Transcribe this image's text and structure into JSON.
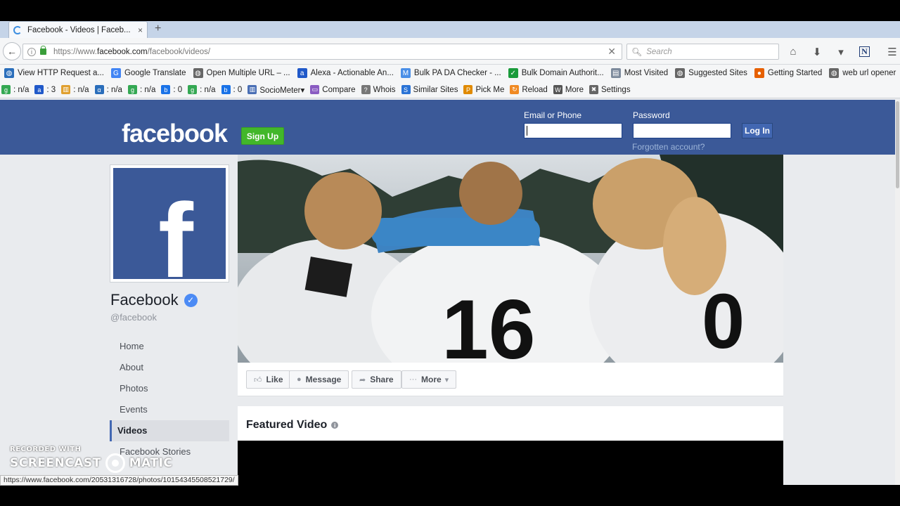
{
  "browser": {
    "tab_title": "Facebook - Videos | Faceb...",
    "tab_close": "×",
    "new_tab": "+",
    "url_prefix": "https://www.",
    "url_domain": "facebook.com",
    "url_path": "/facebook/videos/",
    "search_placeholder": "Search",
    "bookmarks": [
      {
        "label": "View HTTP Request a...",
        "icon": "globe-icon",
        "color": "#2a6ebb"
      },
      {
        "label": "Google Translate",
        "icon": "translate-icon",
        "color": "#4285f4"
      },
      {
        "label": "Open Multiple URL – ...",
        "icon": "globe-icon",
        "color": "#666666"
      },
      {
        "label": "Alexa - Actionable An...",
        "icon": "alexa-icon",
        "color": "#2059c9"
      },
      {
        "label": "Bulk PA DA Checker - ...",
        "icon": "m-icon",
        "color": "#4a8fe7"
      },
      {
        "label": "Bulk Domain Authorit...",
        "icon": "check-icon",
        "color": "#1a9b3b"
      },
      {
        "label": "Most Visited",
        "icon": "folder-icon",
        "color": "#7c8a9c"
      },
      {
        "label": "Suggested Sites",
        "icon": "globe-icon",
        "color": "#666666"
      },
      {
        "label": "Getting Started",
        "icon": "firefox-icon",
        "color": "#e66000"
      },
      {
        "label": "web url opener",
        "icon": "globe-icon",
        "color": "#666666"
      }
    ],
    "toolbar": [
      {
        "label": ": n/a",
        "icon": "google-icon",
        "color": "#34a853"
      },
      {
        "label": ": 3",
        "icon": "alexa-icon",
        "color": "#2059c9"
      },
      {
        "label": ": n/a",
        "icon": "stats-icon",
        "color": "#e0a030"
      },
      {
        "label": ": n/a",
        "icon": "alpha-icon",
        "color": "#2a6ebb"
      },
      {
        "label": ": n/a",
        "icon": "google-icon",
        "color": "#34a853"
      },
      {
        "label": ": 0",
        "icon": "bing-icon",
        "color": "#1a73e8"
      },
      {
        "label": ": n/a",
        "icon": "google-icon",
        "color": "#34a853"
      },
      {
        "label": ": 0",
        "icon": "bing-icon",
        "color": "#1a73e8"
      },
      {
        "label": "SocioMeter▾",
        "icon": "bars-icon",
        "color": "#4a6fb5"
      },
      {
        "label": "Compare",
        "icon": "compare-icon",
        "color": "#8a5cc2"
      },
      {
        "label": "Whois",
        "icon": "question-icon",
        "color": "#777777"
      },
      {
        "label": "Similar Sites",
        "icon": "s-icon",
        "color": "#2a73d6"
      },
      {
        "label": "Pick Me",
        "icon": "pick-icon",
        "color": "#e08a00"
      },
      {
        "label": "Reload",
        "icon": "reload-icon",
        "color": "#f08a24"
      },
      {
        "label": "More",
        "icon": "more-icon",
        "color": "#555555"
      },
      {
        "label": "Settings",
        "icon": "tools-icon",
        "color": "#666666"
      }
    ],
    "status_url": "https://www.facebook.com/20531316728/photos/10154345508521729/"
  },
  "fb": {
    "logo": "facebook",
    "signup": "Sign Up",
    "email_label": "Email or Phone",
    "password_label": "Password",
    "login": "Log In",
    "forgot": "Forgotten account?",
    "page_name": "Facebook",
    "verified": "✓",
    "handle": "@facebook",
    "nav": [
      {
        "label": "Home",
        "active": false
      },
      {
        "label": "About",
        "active": false
      },
      {
        "label": "Photos",
        "active": false
      },
      {
        "label": "Events",
        "active": false
      },
      {
        "label": "Videos",
        "active": true
      },
      {
        "label": "Facebook Stories",
        "active": false
      }
    ],
    "actions": {
      "like": "Like",
      "message": "Message",
      "share": "Share",
      "more": "More"
    },
    "featured_title": "Featured Video",
    "brand_color": "#3b5998",
    "signup_color": "#42b72a"
  },
  "watermark": {
    "line1": "RECORDED WITH",
    "line2a": "SCREENCAST",
    "line2b": "MATIC"
  }
}
